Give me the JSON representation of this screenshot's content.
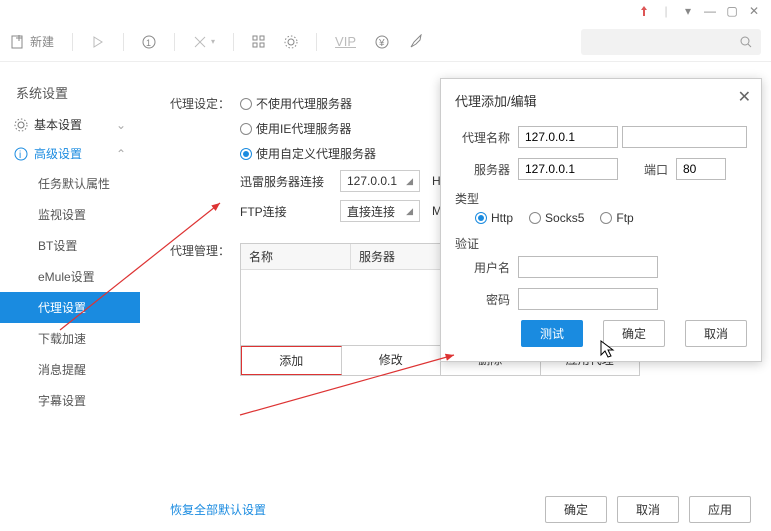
{
  "titlebar": {
    "min": "—",
    "max": "▢",
    "close": "✕",
    "dd": "▾"
  },
  "toolbar": {
    "new": "新建"
  },
  "search": {
    "placeholder": ""
  },
  "sidebar": {
    "title": "系统设置",
    "basic": "基本设置",
    "advanced": "高级设置",
    "items": [
      "任务默认属性",
      "监视设置",
      "BT设置",
      "eMule设置",
      "代理设置",
      "下载加速",
      "消息提醒",
      "字幕设置"
    ]
  },
  "proxy": {
    "setting_label": "代理设定：",
    "radios": [
      "不使用代理服务器",
      "使用IE代理服务器",
      "使用自定义代理服务器"
    ],
    "xl_label": "迅雷服务器连接",
    "xl_value": "127.0.0.1",
    "xl_proto": "HTTP",
    "ftp_label": "FTP连接",
    "ftp_value": "直接连接",
    "ftp_proto": "MMS",
    "manage_label": "代理管理：",
    "cols": [
      "名称",
      "服务器",
      ""
    ],
    "btns": [
      "添加",
      "修改",
      "删除",
      "应用代理"
    ]
  },
  "bottom": {
    "restore": "恢复全部默认设置",
    "ok": "确定",
    "cancel": "取消",
    "apply": "应用"
  },
  "dialog": {
    "title": "代理添加/编辑",
    "name_label": "代理名称",
    "name_value": "127.0.0.1",
    "server_label": "服务器",
    "server_value": "127.0.0.1",
    "port_label": "端口",
    "port_value": "80",
    "type_label": "类型",
    "types": [
      "Http",
      "Socks5",
      "Ftp"
    ],
    "auth_label": "验证",
    "user_label": "用户名",
    "pass_label": "密码",
    "test": "测试",
    "ok": "确定",
    "cancel": "取消"
  },
  "colors": {
    "accent": "#1a8be0",
    "highlight": "#d33"
  }
}
